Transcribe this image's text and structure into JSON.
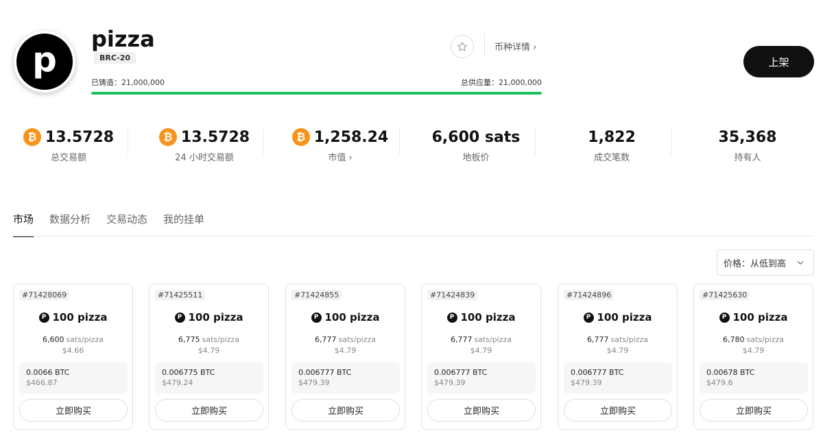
{
  "token": {
    "logo_letter": "p",
    "name": "pizza",
    "tag": "BRC-20",
    "minted_label": "已铸造：21,000,000",
    "supply_label": "总供应量：21,000,000",
    "mint_progress_percent": 100,
    "details_link": "币种详情 ›",
    "list_button": "上架"
  },
  "stats": [
    {
      "value": "13.5728",
      "label": "总交易额",
      "btc": true
    },
    {
      "value": "13.5728",
      "label": "24 小时交易额",
      "btc": true
    },
    {
      "value": "1,258.24",
      "label": "市值 ›",
      "btc": true
    },
    {
      "value": "6,600 sats",
      "label": "地板价",
      "btc": false
    },
    {
      "value": "1,822",
      "label": "成交笔数",
      "btc": false
    },
    {
      "value": "35,368",
      "label": "持有人",
      "btc": false
    }
  ],
  "tabs": [
    "市场",
    "数据分析",
    "交易动态",
    "我的挂单"
  ],
  "active_tab": 0,
  "sort": {
    "label": "价格：从低到高"
  },
  "listings": [
    {
      "id": "#71428069",
      "amount": "100 pizza",
      "price": "6,600",
      "unit": "sats/pizza",
      "usd_unit": "$4.66",
      "btc_total": "0.0066 BTC",
      "usd_total": "$466.87",
      "button": "立即购买"
    },
    {
      "id": "#71425511",
      "amount": "100 pizza",
      "price": "6,775",
      "unit": "sats/pizza",
      "usd_unit": "$4.79",
      "btc_total": "0.006775 BTC",
      "usd_total": "$479.24",
      "button": "立即购买"
    },
    {
      "id": "#71424855",
      "amount": "100 pizza",
      "price": "6,777",
      "unit": "sats/pizza",
      "usd_unit": "$4.79",
      "btc_total": "0.006777 BTC",
      "usd_total": "$479.39",
      "button": "立即购买"
    },
    {
      "id": "#71424839",
      "amount": "100 pizza",
      "price": "6,777",
      "unit": "sats/pizza",
      "usd_unit": "$4.79",
      "btc_total": "0.006777 BTC",
      "usd_total": "$479.39",
      "button": "立即购买"
    },
    {
      "id": "#71424896",
      "amount": "100 pizza",
      "price": "6,777",
      "unit": "sats/pizza",
      "usd_unit": "$4.79",
      "btc_total": "0.006777 BTC",
      "usd_total": "$479.39",
      "button": "立即购买"
    },
    {
      "id": "#71425630",
      "amount": "100 pizza",
      "price": "6,780",
      "unit": "sats/pizza",
      "usd_unit": "$4.79",
      "btc_total": "0.00678 BTC",
      "usd_total": "$479.6",
      "button": "立即购买"
    }
  ],
  "colors": {
    "accent": "#1dbf5a",
    "btc": "#f7931a",
    "primary_button": "#111111"
  },
  "icons": {
    "favorite": "star-icon",
    "btc": "bitcoin-icon",
    "sort": "chevron-down-icon",
    "token": "pizza-token-icon"
  }
}
